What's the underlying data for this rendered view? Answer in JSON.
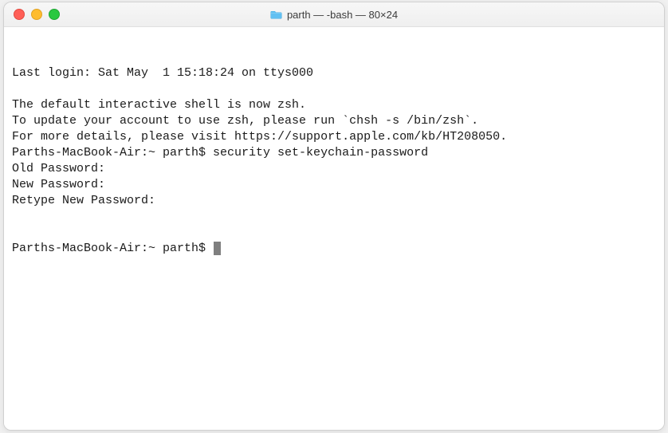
{
  "window": {
    "title": "parth — -bash — 80×24"
  },
  "terminal": {
    "lines": [
      "Last login: Sat May  1 15:18:24 on ttys000",
      "",
      "The default interactive shell is now zsh.",
      "To update your account to use zsh, please run `chsh -s /bin/zsh`.",
      "For more details, please visit https://support.apple.com/kb/HT208050.",
      "Parths-MacBook-Air:~ parth$ security set-keychain-password",
      "Old Password:",
      "New Password:",
      "Retype New Password:"
    ],
    "prompt": "Parths-MacBook-Air:~ parth$ "
  }
}
